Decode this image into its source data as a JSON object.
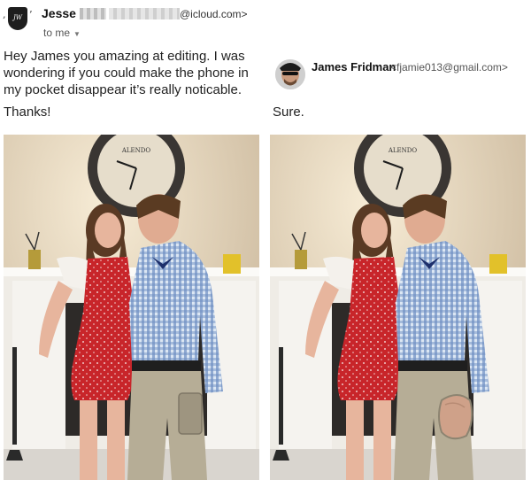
{
  "request": {
    "sender_name": "Jesse",
    "sender_domain": "@icloud.com>",
    "recipient": "to me",
    "avatar_initials": "JW",
    "message": "Hey James you amazing at editing. I was wondering if you could make the phone in my pocket disappear it’s really noticable.",
    "signoff": "Thanks!"
  },
  "reply": {
    "sender_name": "James Fridman",
    "sender_email": "<fjamie013@gmail.com>",
    "message": "Sure."
  },
  "photos": {
    "original": "photo-original",
    "edited": "photo-edited",
    "clock_brand": "ALENDO"
  },
  "icons": [
    "shield-avatar-icon",
    "chevron-down-icon",
    "profile-avatar-icon"
  ]
}
